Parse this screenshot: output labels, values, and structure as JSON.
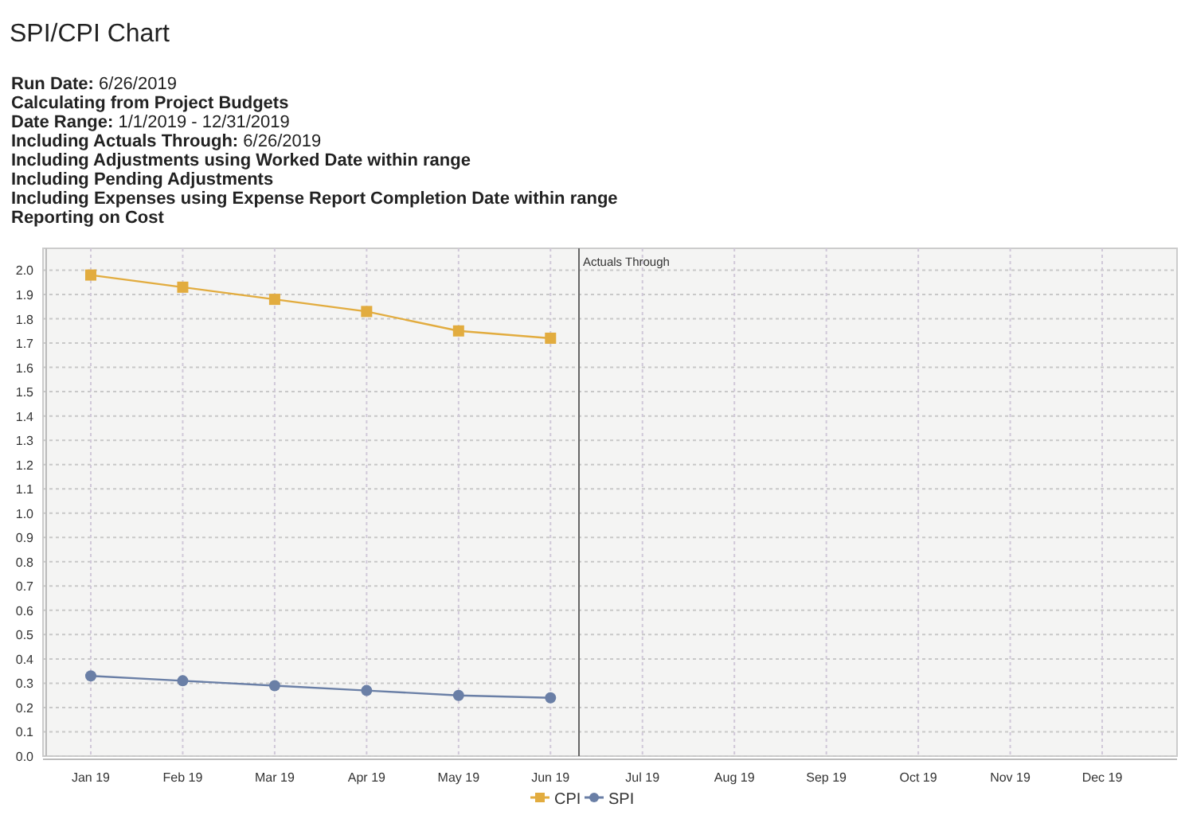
{
  "title": "SPI/CPI Chart",
  "info_lines": [
    {
      "label": "Run Date:",
      "value": "6/26/2019"
    },
    {
      "label": "Calculating from Project Budgets"
    },
    {
      "label": "Date Range:",
      "value": "1/1/2019 - 12/31/2019"
    },
    {
      "label": "Including Actuals Through:",
      "value": "6/26/2019"
    },
    {
      "label": "Including Adjustments using Worked Date within range"
    },
    {
      "label": "Including Pending Adjustments"
    },
    {
      "label": "Including Expenses using Expense Report Completion Date within range"
    },
    {
      "label": "Reporting on Cost"
    }
  ],
  "chart": {
    "chart_data": {
      "type": "line",
      "categories": [
        "Jan 19",
        "Feb 19",
        "Mar 19",
        "Apr 19",
        "May 19",
        "Jun 19",
        "Jul 19",
        "Aug 19",
        "Sep 19",
        "Oct 19",
        "Nov 19",
        "Dec 19"
      ],
      "series": [
        {
          "name": "CPI",
          "color": "#e2ac3f",
          "marker": "square",
          "values": [
            1.98,
            1.93,
            1.88,
            1.83,
            1.75,
            1.72,
            null,
            null,
            null,
            null,
            null,
            null
          ]
        },
        {
          "name": "SPI",
          "color": "#6a7fa6",
          "marker": "circle",
          "values": [
            0.33,
            0.31,
            0.29,
            0.27,
            0.25,
            0.24,
            null,
            null,
            null,
            null,
            null,
            null
          ]
        }
      ],
      "ylim": [
        0,
        2.09
      ],
      "yticks": [
        {
          "value": 0,
          "label": "0.0"
        },
        0.1,
        0.2,
        0.3,
        0.4,
        0.5,
        0.6,
        0.7,
        0.8,
        0.9,
        {
          "value": 1,
          "label": "1.0"
        },
        1.1,
        1.2,
        1.3,
        1.4,
        1.5,
        1.6,
        1.7,
        1.8,
        1.9,
        {
          "value": 2,
          "label": "2.0"
        }
      ],
      "grid": true,
      "legend": true,
      "annotations": [
        {
          "text": "Actuals Through"
        }
      ]
    }
  }
}
